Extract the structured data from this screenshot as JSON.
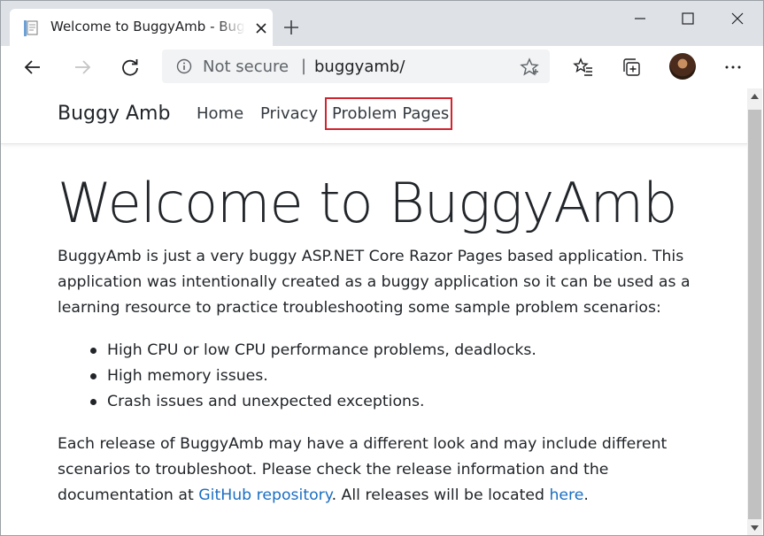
{
  "browser": {
    "tab_title": "Welcome to BuggyAmb - BuggyAmb",
    "address_security": "Not secure",
    "address_separator": "|",
    "url": "buggyamb/",
    "icons": {
      "favicon": "page-icon",
      "close": "close-icon",
      "new_tab": "plus-icon",
      "back": "back-arrow-icon",
      "forward": "forward-arrow-icon",
      "refresh": "refresh-icon",
      "info": "info-icon",
      "favorite": "star-icon",
      "favorites": "favorites-list-icon",
      "collections": "collections-icon",
      "menu": "more-icon"
    }
  },
  "site": {
    "brand": "Buggy Amb",
    "nav": [
      {
        "label": "Home"
      },
      {
        "label": "Privacy"
      },
      {
        "label": "Problem Pages"
      }
    ],
    "highlight_color": "#d1242f"
  },
  "main": {
    "heading": "Welcome to BuggyAmb",
    "intro": "BuggyAmb is just a very buggy ASP.NET Core Razor Pages based application. This application was intentionally created as a buggy application so it can be used as a learning resource to practice troubleshooting some sample problem scenarios:",
    "bullets": [
      "High CPU or low CPU performance problems, deadlocks.",
      "High memory issues.",
      "Crash issues and unexpected exceptions."
    ],
    "release_prefix": "Each release of BuggyAmb may have a different look and may include different scenarios to troubleshoot. Please check the release information and the documentation at ",
    "github_link": "GitHub repository",
    "release_middle": ". All releases will be located ",
    "here_link": "here",
    "release_suffix": ".",
    "link_color": "#1b6ec2"
  }
}
